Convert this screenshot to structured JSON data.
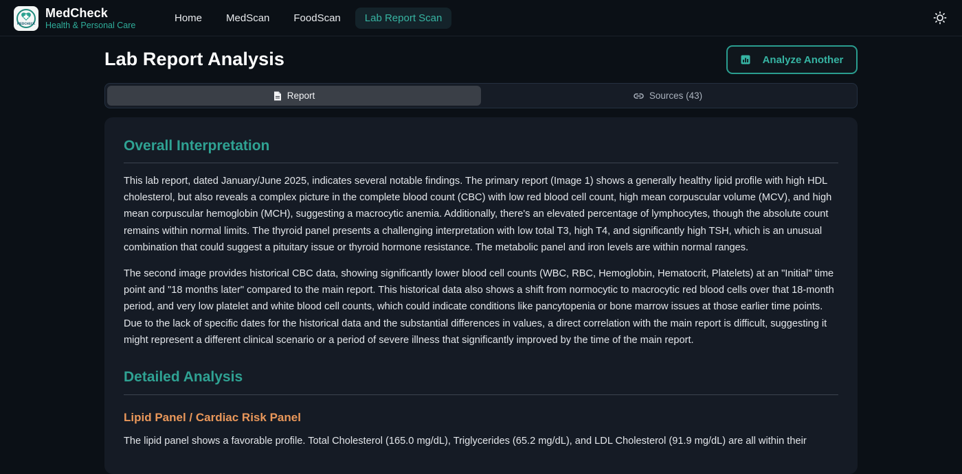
{
  "brand": {
    "name": "MedCheck",
    "tagline": "Health & Personal Care",
    "logo_text": "MEDCHECK"
  },
  "nav": {
    "items": [
      {
        "label": "Home",
        "active": false
      },
      {
        "label": "MedScan",
        "active": false
      },
      {
        "label": "FoodScan",
        "active": false
      },
      {
        "label": "Lab Report Scan",
        "active": true
      }
    ]
  },
  "header": {
    "theme_toggle_icon": "sun-icon"
  },
  "page": {
    "title": "Lab Report Analysis",
    "analyze_button": "Analyze Another"
  },
  "tabs": [
    {
      "label": "Report",
      "icon": "document-icon",
      "active": true
    },
    {
      "label": "Sources (43)",
      "icon": "link-icon",
      "active": false
    }
  ],
  "report": {
    "overall_heading": "Overall Interpretation",
    "overall_paragraphs": [
      "This lab report, dated January/June 2025, indicates several notable findings. The primary report (Image 1) shows a generally healthy lipid profile with high HDL cholesterol, but also reveals a complex picture in the complete blood count (CBC) with low red blood cell count, high mean corpuscular volume (MCV), and high mean corpuscular hemoglobin (MCH), suggesting a macrocytic anemia. Additionally, there's an elevated percentage of lymphocytes, though the absolute count remains within normal limits. The thyroid panel presents a challenging interpretation with low total T3, high T4, and significantly high TSH, which is an unusual combination that could suggest a pituitary issue or thyroid hormone resistance. The metabolic panel and iron levels are within normal ranges.",
      "The second image provides historical CBC data, showing significantly lower blood cell counts (WBC, RBC, Hemoglobin, Hematocrit, Platelets) at an \"Initial\" time point and \"18 months later\" compared to the main report. This historical data also shows a shift from normocytic to macrocytic red blood cells over that 18-month period, and very low platelet and white blood cell counts, which could indicate conditions like pancytopenia or bone marrow issues at those earlier time points. Due to the lack of specific dates for the historical data and the substantial differences in values, a direct correlation with the main report is difficult, suggesting it might represent a different clinical scenario or a period of severe illness that significantly improved by the time of the main report."
    ],
    "detailed_heading": "Detailed Analysis",
    "lipid_heading": "Lipid Panel / Cardiac Risk Panel",
    "lipid_paragraph": "The lipid panel shows a favorable profile. Total Cholesterol (165.0 mg/dL), Triglycerides (65.2 mg/dL), and LDL Cholesterol (91.9 mg/dL) are all within their"
  },
  "colors": {
    "accent": "#2fa293",
    "subheading": "#e9975a",
    "background": "#0b1016",
    "card": "#151b25"
  }
}
